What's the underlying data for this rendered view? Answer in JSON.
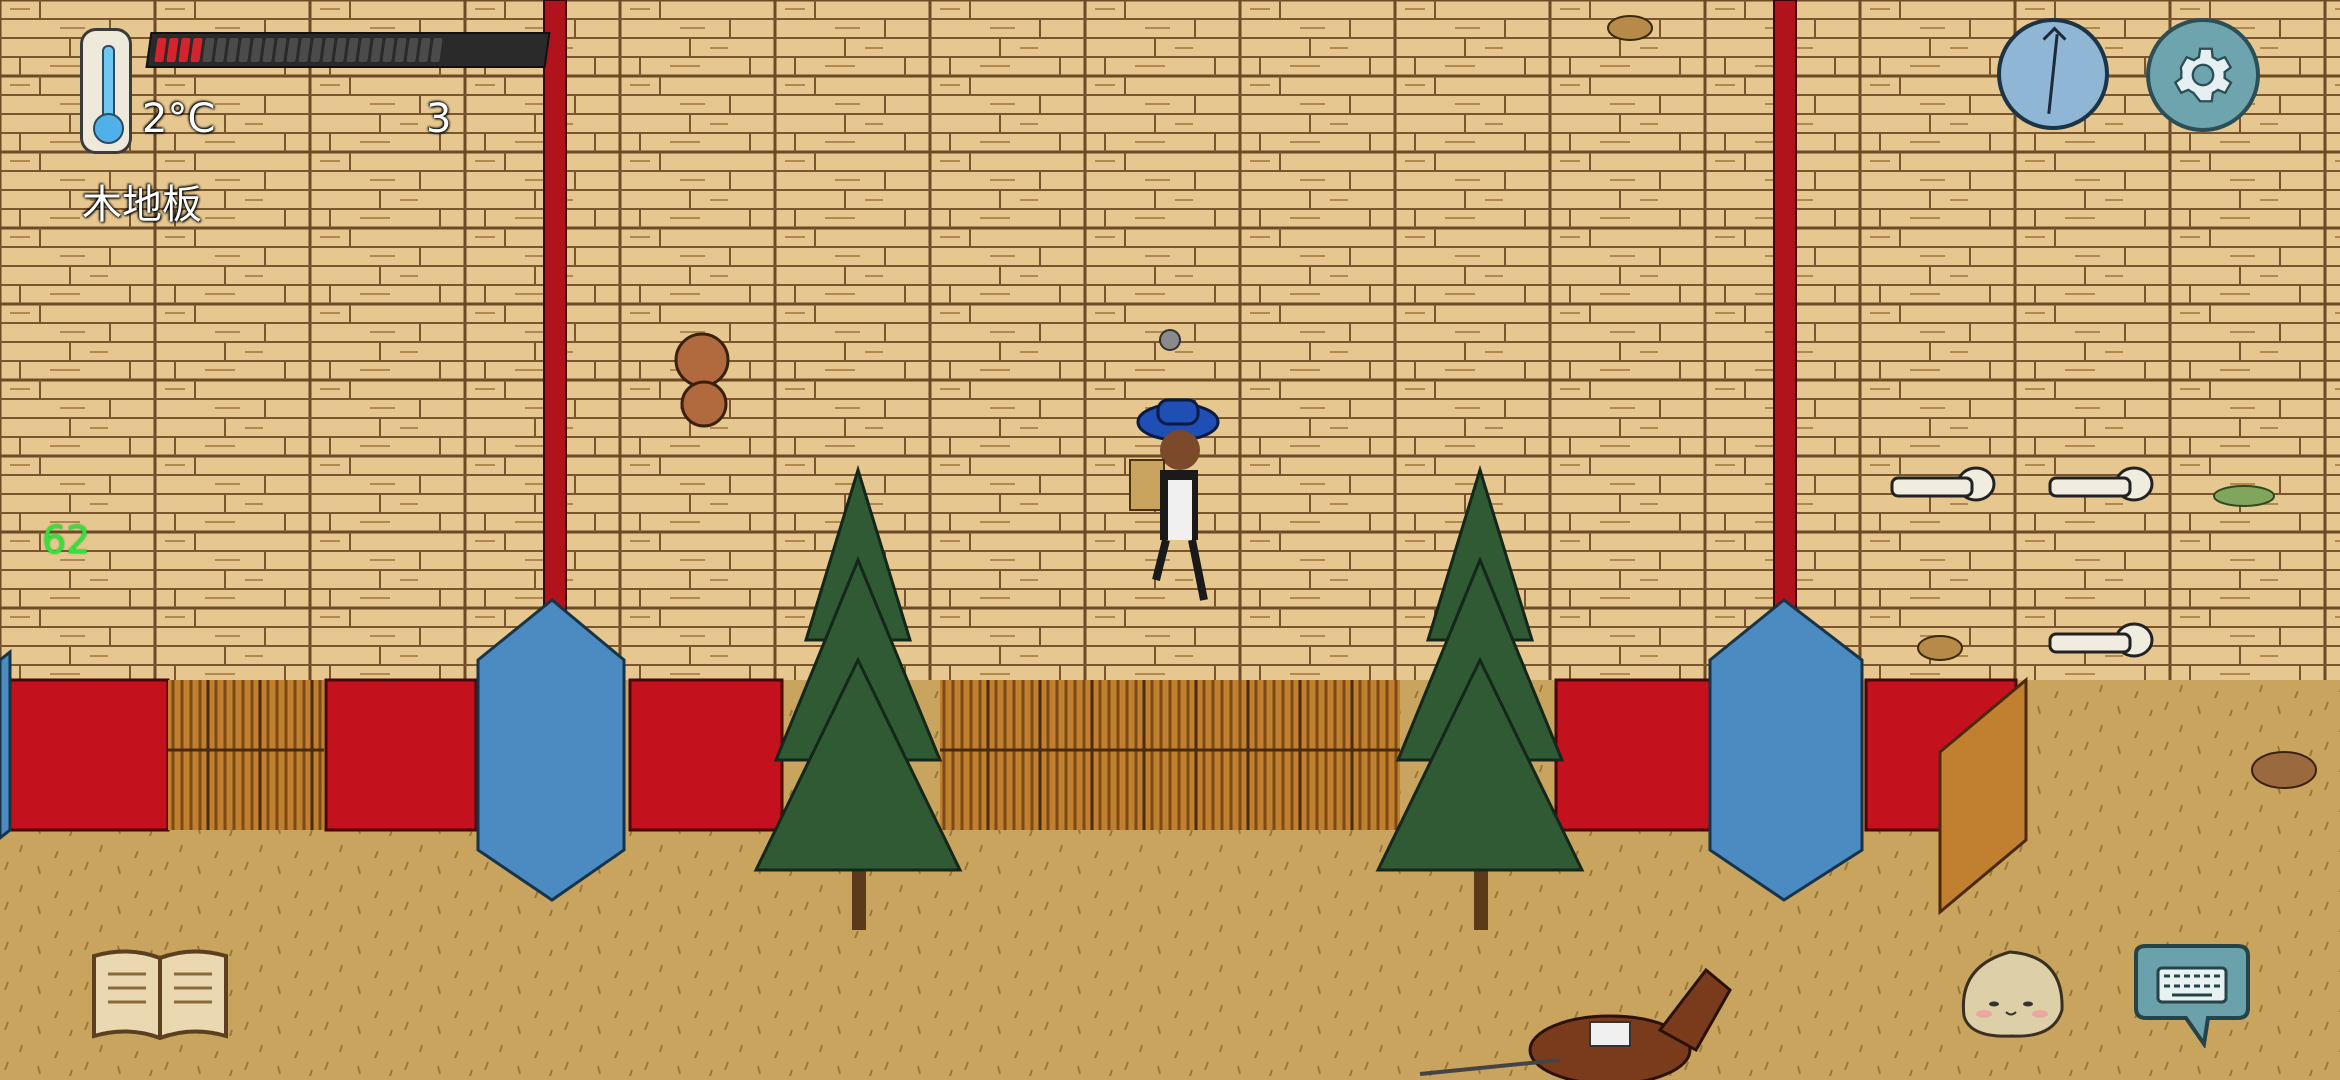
{
  "hud": {
    "temperature": "2°C",
    "food_count": "3",
    "tile_name": "木地板",
    "fps": "62",
    "hunger": {
      "filled": 4,
      "total": 24
    },
    "colors": {
      "hunger_fill": "#d4252f",
      "hunger_empty": "#4b4b4b",
      "fps": "#35e03a"
    }
  },
  "icons": {
    "thermometer": "thermometer-icon",
    "compass": "compass-icon",
    "settings": "gear-icon",
    "recipe_book": "book-icon",
    "emote": "emote-face-icon",
    "chat": "keyboard-icon"
  }
}
